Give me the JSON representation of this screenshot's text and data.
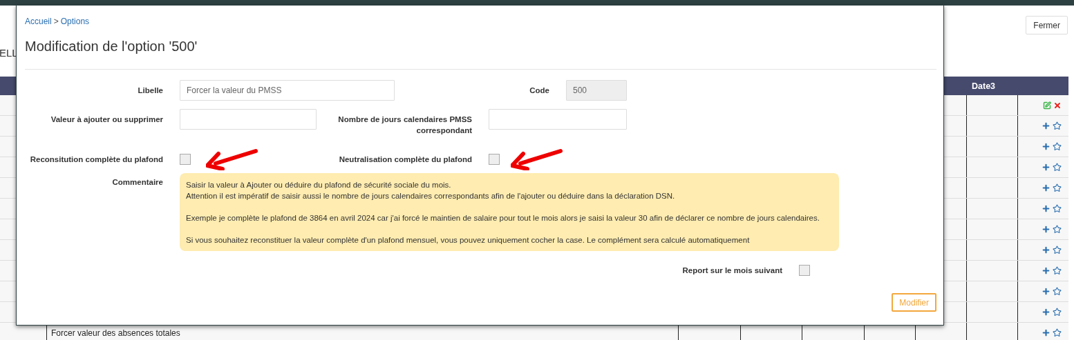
{
  "page": {
    "title_fragment": "ELL",
    "close_button": "Fermer"
  },
  "table": {
    "header": "Date3",
    "rows": [
      {
        "kind": "edit"
      },
      {
        "kind": "add"
      },
      {
        "kind": "add"
      },
      {
        "kind": "add"
      },
      {
        "kind": "add"
      },
      {
        "kind": "add"
      },
      {
        "kind": "add"
      },
      {
        "kind": "add"
      },
      {
        "kind": "add"
      },
      {
        "kind": "add"
      },
      {
        "kind": "add"
      },
      {
        "kind": "add",
        "label": "Forcer valeur des absences totales"
      }
    ]
  },
  "dialog": {
    "breadcrumb": [
      {
        "label": "Accueil"
      },
      {
        "label": "Options"
      }
    ],
    "breadcrumb_separator": ">",
    "title": "Modification de l'option '500'",
    "libelle": {
      "label": "Libelle",
      "value": "Forcer la valeur du PMSS"
    },
    "code": {
      "label": "Code",
      "value": "500",
      "disabled": true
    },
    "valeur": {
      "label": "Valeur à ajouter ou supprimer"
    },
    "jours": {
      "label": "Nombre de jours calendaires PMSS correspondant"
    },
    "reconstitution": {
      "label": "Reconsitution complète du plafond",
      "checked": false
    },
    "neutralisation": {
      "label": "Neutralisation complète du plafond",
      "checked": false
    },
    "commentaire": {
      "label": "Commentaire",
      "paragraphs": [
        [
          "Saisir la valeur à Ajouter ou déduire du plafond de sécurité sociale du mois.",
          "Attention il est impératif de saisir aussi le nombre de jours calendaires correspondants afin de l'ajouter ou déduire dans la déclaration DSN."
        ],
        [
          "Exemple je complète le plafond de 3864 en avril 2024 car j'ai forcé le maintien de salaire pour tout le mois alors je saisi la valeur 30 afin de déclarer ce nombre de jours calendaires."
        ],
        [
          "Si vous souhaitez reconstituer la valeur complète d'un plafond mensuel, vous pouvez uniquement cocher la case. Le complément sera calculé automatiquement"
        ]
      ]
    },
    "report": {
      "label": "Report sur le mois suivant",
      "checked": false
    },
    "submit": "Modifier"
  }
}
